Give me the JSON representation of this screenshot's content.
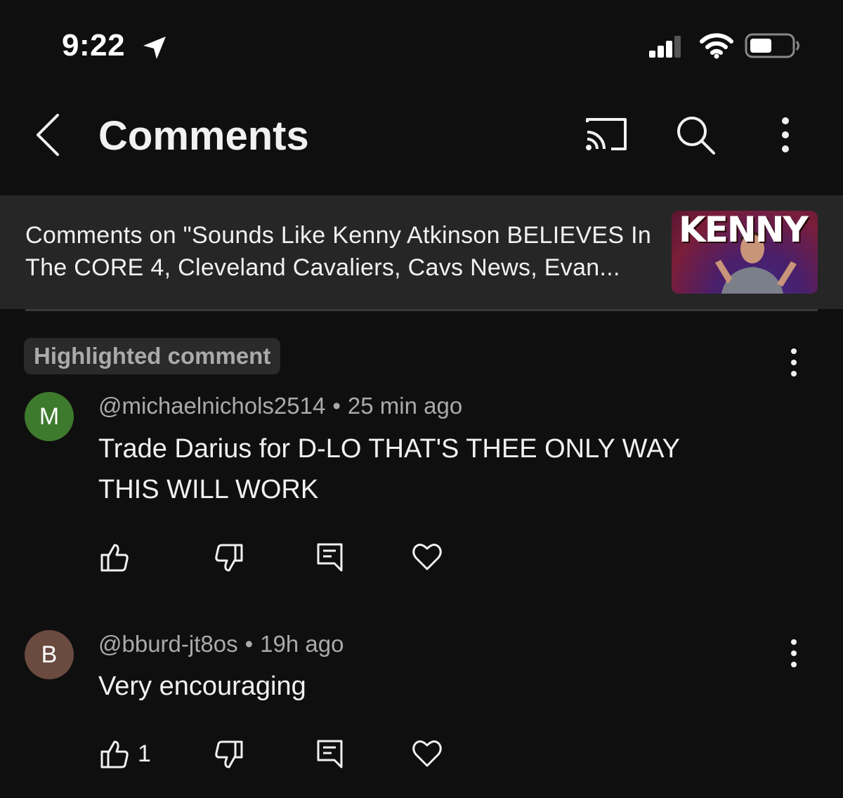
{
  "status_bar": {
    "time": "9:22"
  },
  "header": {
    "title": "Comments"
  },
  "video": {
    "context_text": "Comments on \"Sounds Like Kenny Atkinson BELIEVES In The CORE 4, Cleveland Cavaliers, Cavs News, Evan...",
    "thumbnail_text": "KENNY"
  },
  "highlighted": {
    "label": "Highlighted comment"
  },
  "comments": [
    {
      "avatar_letter": "M",
      "avatar_color": "#3e7a2e",
      "author": "@michaelnichols2514",
      "separator": "•",
      "time": "25 min ago",
      "text_line1": "Trade Darius for D-LO THAT'S THEE ONLY WAY",
      "text_line2": "THIS WILL WORK",
      "likes": ""
    },
    {
      "avatar_letter": "B",
      "avatar_color": "#6b4a40",
      "author": "@bburd-jt8os",
      "separator": "•",
      "time": "19h ago",
      "text_line1": "Very encouraging",
      "text_line2": "",
      "likes": "1"
    }
  ],
  "icons": {
    "back": "chevron-left-icon",
    "cast": "cast-icon",
    "search": "search-icon",
    "more": "more-vertical-icon",
    "like": "thumb-up-icon",
    "dislike": "thumb-down-icon",
    "reply": "reply-icon",
    "heart": "heart-icon"
  }
}
